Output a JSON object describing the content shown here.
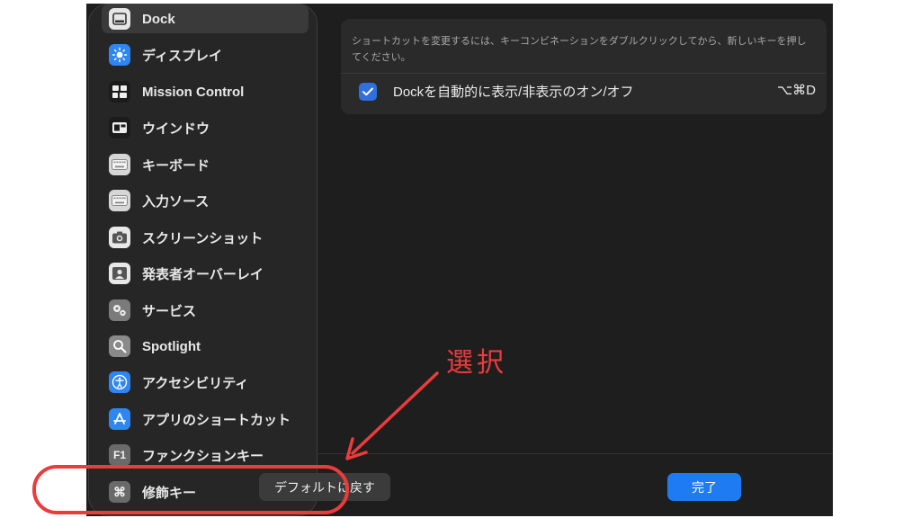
{
  "sidebar": {
    "items": [
      {
        "label": "Dock",
        "icon": "dock-icon",
        "selected": true
      },
      {
        "label": "ディスプレイ",
        "icon": "display-sun-icon"
      },
      {
        "label": "Mission Control",
        "icon": "mission-control-icon"
      },
      {
        "label": "ウインドウ",
        "icon": "window-icon"
      },
      {
        "label": "キーボード",
        "icon": "keyboard-icon"
      },
      {
        "label": "入力ソース",
        "icon": "input-source-keyboard-icon"
      },
      {
        "label": "スクリーンショット",
        "icon": "screenshot-camera-icon"
      },
      {
        "label": "発表者オーバーレイ",
        "icon": "presenter-overlay-icon"
      },
      {
        "label": "サービス",
        "icon": "services-gear-icon"
      },
      {
        "label": "Spotlight",
        "icon": "spotlight-search-icon"
      },
      {
        "label": "アクセシビリティ",
        "icon": "accessibility-icon"
      },
      {
        "label": "アプリのショートカット",
        "icon": "app-store-icon"
      },
      {
        "label": "ファンクションキー",
        "icon": "function-key-icon",
        "icon_text": "F1"
      },
      {
        "label": "修飾キー",
        "icon": "command-key-icon",
        "icon_text": "⌘"
      }
    ]
  },
  "panel": {
    "instruction": "ショートカットを変更するには、キーコンビネーションをダブルクリックしてから、新しいキーを押してください。",
    "shortcuts": [
      {
        "label": "Dockを自動的に表示/非表示のオン/オフ",
        "key": "⌥⌘D",
        "checked": true
      }
    ]
  },
  "buttons": {
    "restore_defaults": "デフォルトに戻す",
    "done": "完了"
  },
  "annotation": {
    "text": "選択",
    "color": "#ec3b3b"
  },
  "colors": {
    "accent_blue": "#1f7bf2",
    "checkbox_blue": "#2f6fde",
    "window_bg": "#1e1e1e",
    "sidebar_bg": "#262626"
  }
}
